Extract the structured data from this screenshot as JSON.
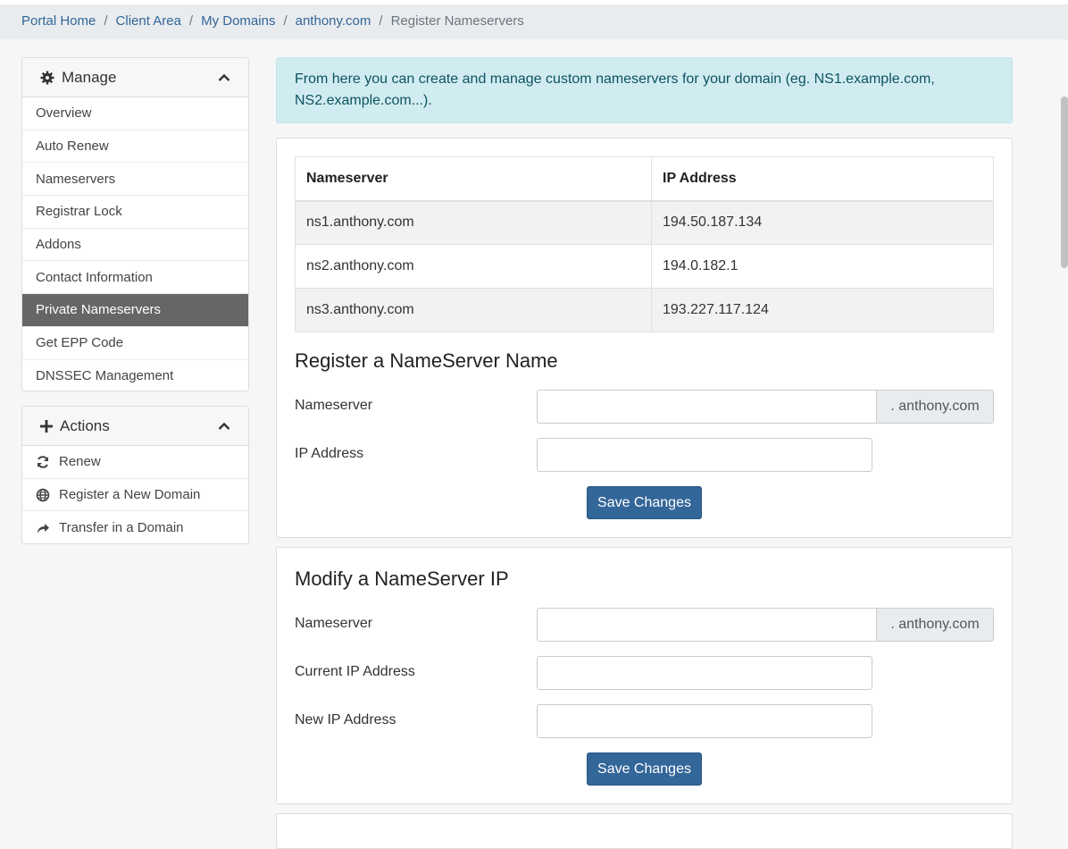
{
  "breadcrumb": [
    "Portal Home",
    "Client Area",
    "My Domains",
    "anthony.com",
    "Register Nameservers"
  ],
  "manage": {
    "title": "Manage",
    "items": [
      "Overview",
      "Auto Renew",
      "Nameservers",
      "Registrar Lock",
      "Addons",
      "Contact Information",
      "Private Nameservers",
      "Get EPP Code",
      "DNSSEC Management"
    ],
    "active": "Private Nameservers"
  },
  "actions": {
    "title": "Actions",
    "items": [
      {
        "label": "Renew",
        "icon": "refresh-icon"
      },
      {
        "label": "Register a New Domain",
        "icon": "globe-icon"
      },
      {
        "label": "Transfer in a Domain",
        "icon": "share-arrow-icon"
      }
    ]
  },
  "info": "From here you can create and manage custom nameservers for your domain (eg. NS1.example.com, NS2.example.com...).",
  "table": {
    "headers": [
      "Nameserver",
      "IP Address"
    ],
    "rows": [
      [
        "ns1.anthony.com",
        "194.50.187.134"
      ],
      [
        "ns2.anthony.com",
        "194.0.182.1"
      ],
      [
        "ns3.anthony.com",
        "193.227.117.124"
      ]
    ]
  },
  "register": {
    "title": "Register a NameServer Name",
    "nameserver_label": "Nameserver",
    "suffix": ". anthony.com",
    "ip_label": "IP Address",
    "save": "Save Changes"
  },
  "modify": {
    "title": "Modify a NameServer IP",
    "nameserver_label": "Nameserver",
    "suffix": ". anthony.com",
    "current_ip_label": "Current IP Address",
    "new_ip_label": "New IP Address",
    "save": "Save Changes"
  },
  "colors": {
    "accent": "#336699",
    "active_item": "#666666",
    "info_bg": "#d1ecf1"
  }
}
